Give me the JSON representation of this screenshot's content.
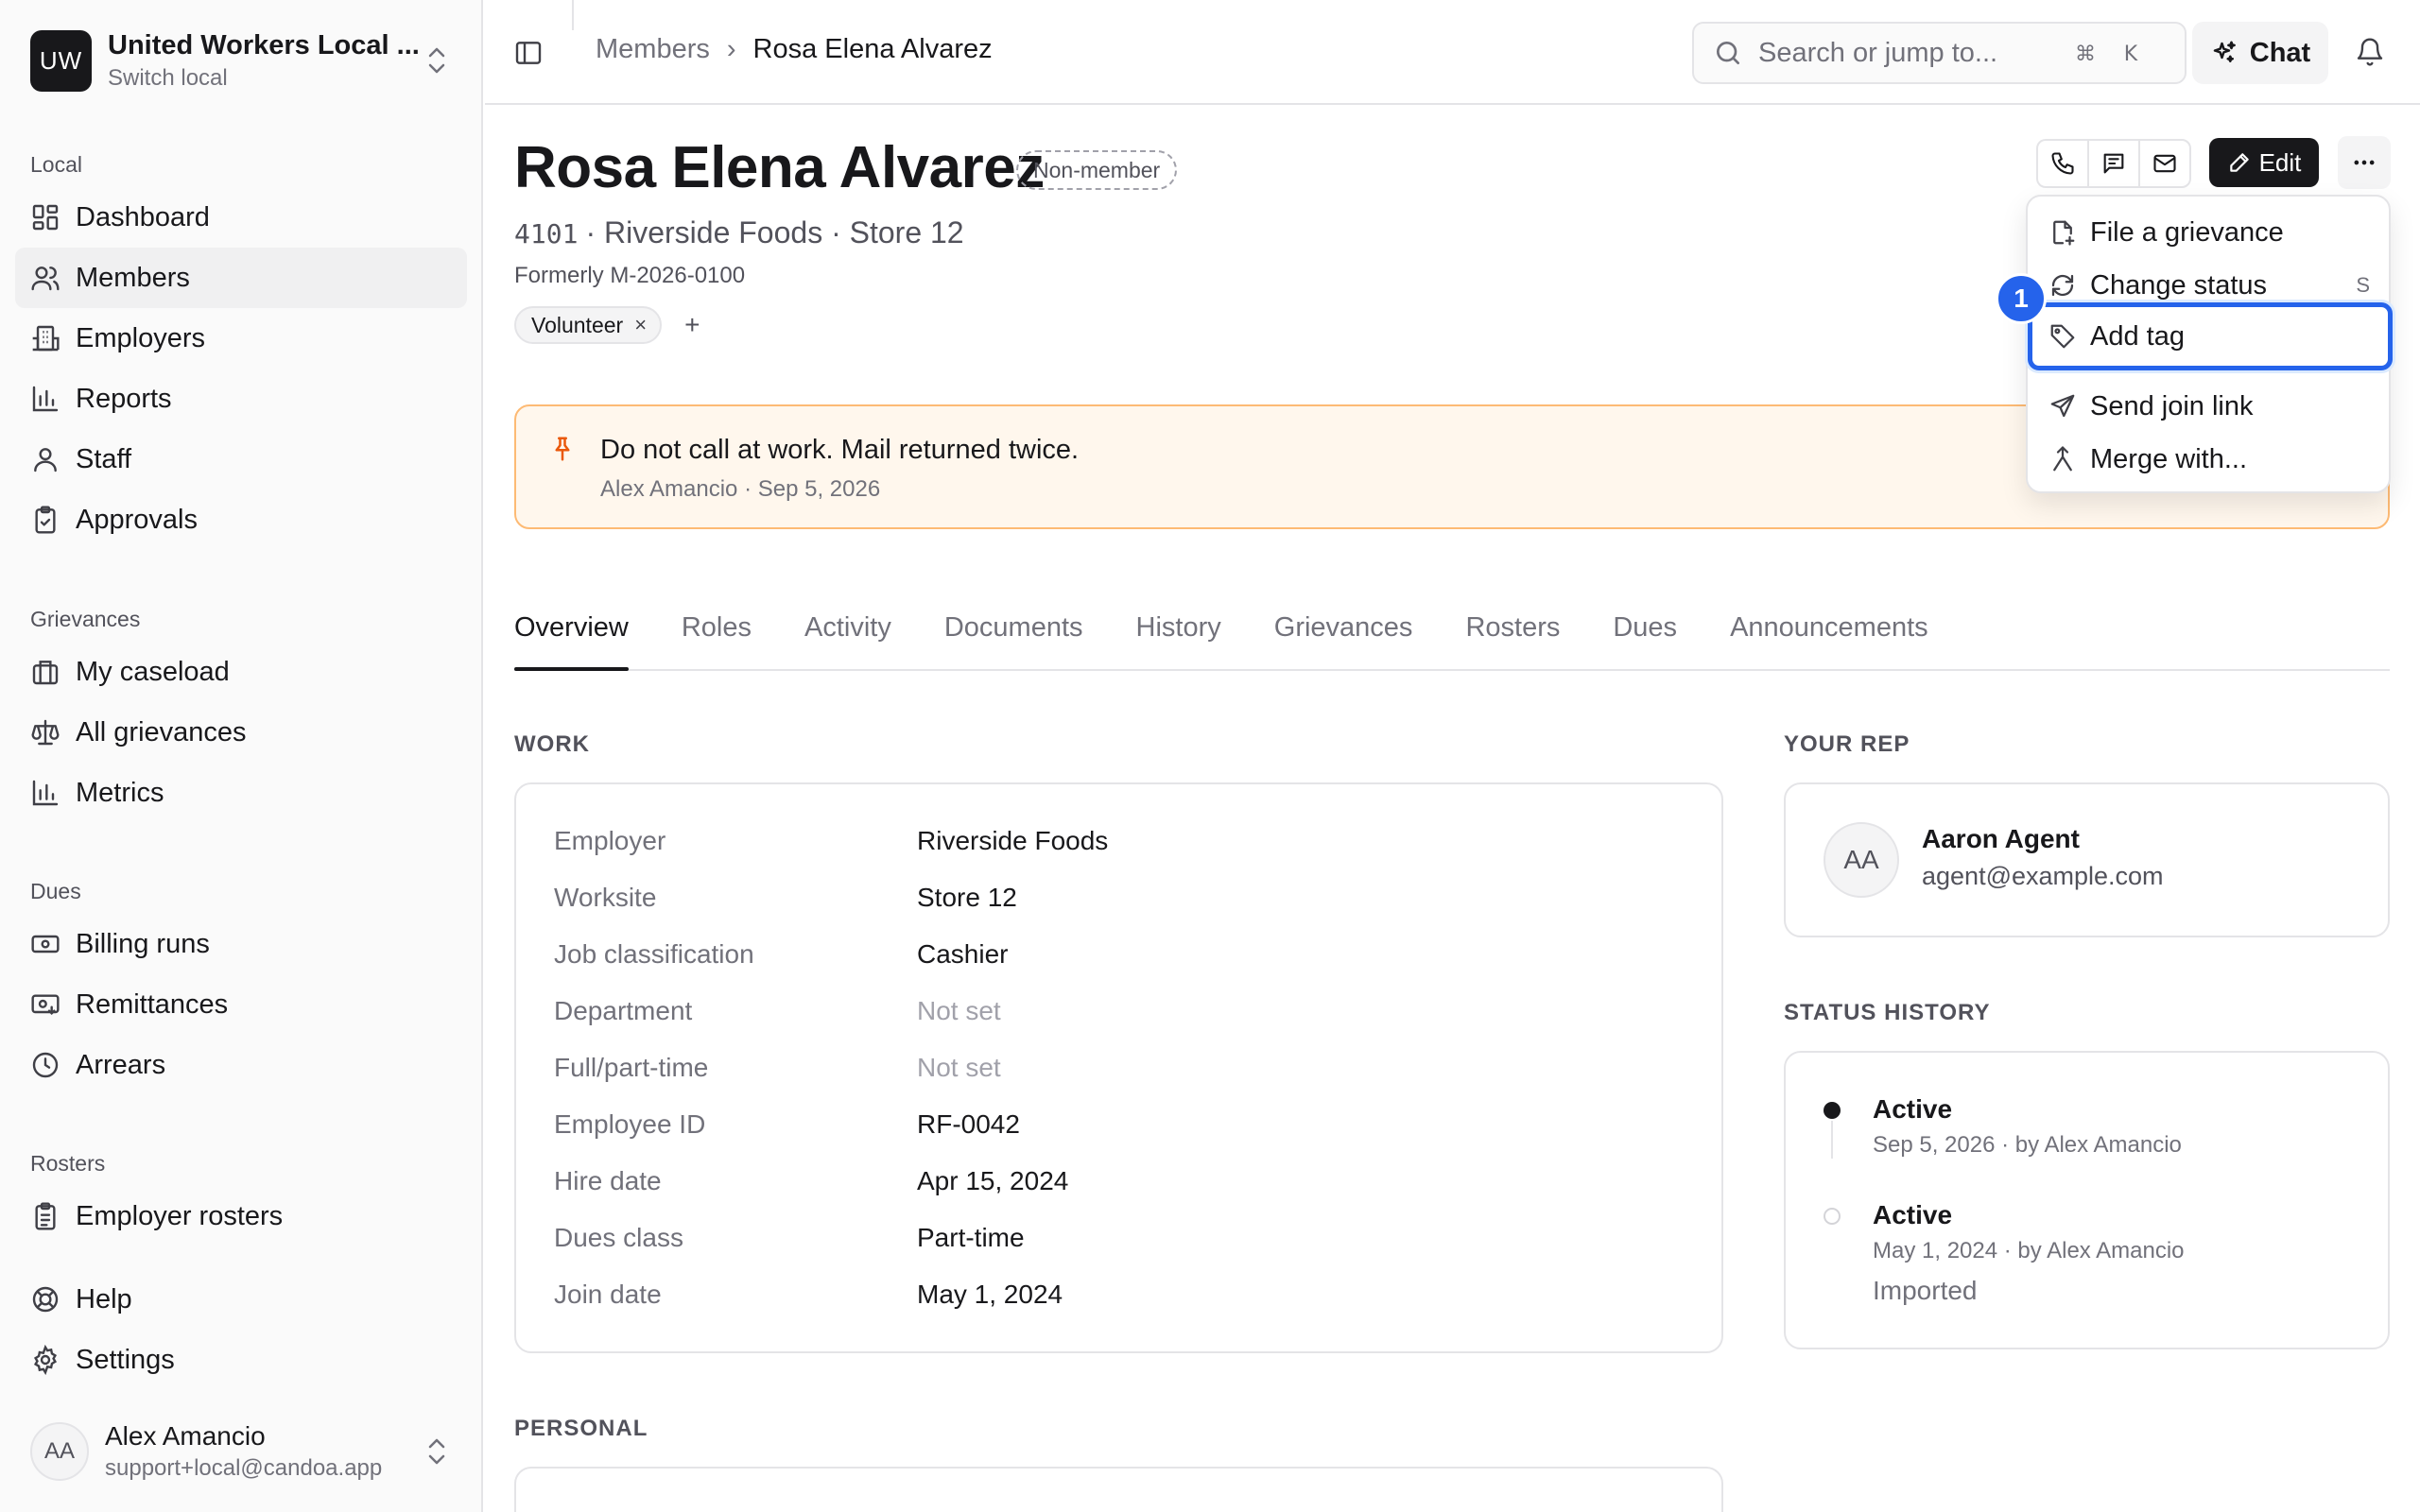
{
  "sidebar": {
    "org": {
      "initials": "UW",
      "name": "United Workers Local ...",
      "sub": "Switch local"
    },
    "groups": [
      {
        "heading": "Local",
        "items": [
          {
            "label": "Dashboard",
            "icon": "dashboard-icon"
          },
          {
            "label": "Members",
            "icon": "users-icon",
            "active": true
          },
          {
            "label": "Employers",
            "icon": "building-icon"
          },
          {
            "label": "Reports",
            "icon": "bar-chart-icon"
          },
          {
            "label": "Staff",
            "icon": "user-icon"
          },
          {
            "label": "Approvals",
            "icon": "clipboard-check-icon"
          }
        ]
      },
      {
        "heading": "Grievances",
        "items": [
          {
            "label": "My caseload",
            "icon": "briefcase-icon"
          },
          {
            "label": "All grievances",
            "icon": "scale-icon"
          },
          {
            "label": "Metrics",
            "icon": "bar-chart-icon"
          }
        ]
      },
      {
        "heading": "Dues",
        "items": [
          {
            "label": "Billing runs",
            "icon": "banknote-icon"
          },
          {
            "label": "Remittances",
            "icon": "receipt-icon"
          },
          {
            "label": "Arrears",
            "icon": "clock-icon"
          }
        ]
      },
      {
        "heading": "Rosters",
        "items": [
          {
            "label": "Employer rosters",
            "icon": "clipboard-list-icon"
          }
        ]
      }
    ],
    "footer_items": [
      {
        "label": "Help",
        "icon": "lifebuoy-icon"
      },
      {
        "label": "Settings",
        "icon": "gear-icon"
      }
    ],
    "user": {
      "initials": "AA",
      "name": "Alex Amancio",
      "email": "support+local@candoa.app"
    }
  },
  "topbar": {
    "breadcrumb": {
      "parent": "Members",
      "separator": "›",
      "current": "Rosa Elena Alvarez"
    },
    "search": {
      "placeholder": "Search or jump to...",
      "kbd1": "⌘",
      "kbd2": "K"
    },
    "chat_label": "Chat"
  },
  "member": {
    "name": "Rosa Elena Alvarez",
    "status_badge": "Non-member",
    "number": "4101",
    "employer_line": "· Riverside Foods · Store 12",
    "formerly": "Formerly M-2026-0100",
    "tags": [
      "Volunteer"
    ],
    "tag_remove": "×",
    "tag_add": "+"
  },
  "actions": {
    "edit_label": "Edit"
  },
  "note": {
    "text": "Do not call at work. Mail returned twice.",
    "meta": "Alex Amancio · Sep 5, 2026"
  },
  "menu": {
    "items": [
      {
        "label": "File a grievance",
        "icon": "file-plus-icon"
      },
      {
        "label": "Change status",
        "icon": "refresh-icon",
        "shortcut": "S"
      },
      {
        "label": "Add tag",
        "icon": "tag-icon",
        "highlighted": true
      },
      {
        "label": "Send join link",
        "icon": "send-icon"
      },
      {
        "label": "Merge with...",
        "icon": "merge-icon"
      }
    ],
    "step_badge": "1"
  },
  "tabs": [
    "Overview",
    "Roles",
    "Activity",
    "Documents",
    "History",
    "Grievances",
    "Rosters",
    "Dues",
    "Announcements"
  ],
  "work": {
    "heading": "WORK",
    "rows": [
      {
        "label": "Employer",
        "value": "Riverside Foods"
      },
      {
        "label": "Worksite",
        "value": "Store 12"
      },
      {
        "label": "Job classification",
        "value": "Cashier"
      },
      {
        "label": "Department",
        "value": "Not set",
        "muted": true
      },
      {
        "label": "Full/part-time",
        "value": "Not set",
        "muted": true
      },
      {
        "label": "Employee ID",
        "value": "RF-0042"
      },
      {
        "label": "Hire date",
        "value": "Apr 15, 2024"
      },
      {
        "label": "Dues class",
        "value": "Part-time"
      },
      {
        "label": "Join date",
        "value": "May 1, 2024"
      }
    ]
  },
  "rep": {
    "heading": "YOUR REP",
    "initials": "AA",
    "name": "Aaron Agent",
    "email": "agent@example.com"
  },
  "status_history": {
    "heading": "STATUS HISTORY",
    "entries": [
      {
        "status": "Active",
        "meta": "Sep 5, 2026 · by Alex Amancio",
        "note": ""
      },
      {
        "status": "Active",
        "meta": "May 1, 2024 · by Alex Amancio",
        "note": "Imported"
      }
    ]
  },
  "personal": {
    "heading": "PERSONAL"
  },
  "colors": {
    "accent": "#2563eb",
    "note_bg": "#fff7ed",
    "note_border": "#fdba74",
    "dark": "#18181b"
  }
}
